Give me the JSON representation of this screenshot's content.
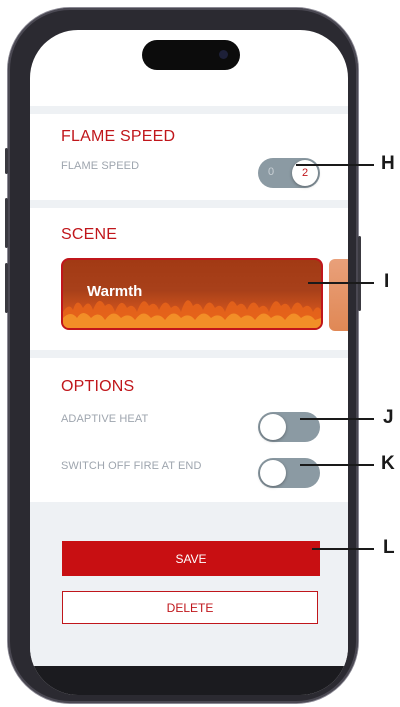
{
  "flame_speed": {
    "title": "FLAME SPEED",
    "row_label": "FLAME SPEED",
    "toggle_options": [
      "0",
      "2"
    ]
  },
  "scene": {
    "title": "SCENE",
    "card_name": "Warmth"
  },
  "options": {
    "title": "OPTIONS",
    "adaptive_heat_label": "ADAPTIVE HEAT",
    "switch_off_label": "SWITCH OFF FIRE AT END"
  },
  "actions": {
    "save_label": "SAVE",
    "delete_label": "DELETE"
  },
  "callouts": [
    "H",
    "I",
    "J",
    "K",
    "L"
  ],
  "colors": {
    "accent": "#c0161b",
    "toggle_track": "#8b9aa3",
    "separator": "#eef1f4"
  }
}
